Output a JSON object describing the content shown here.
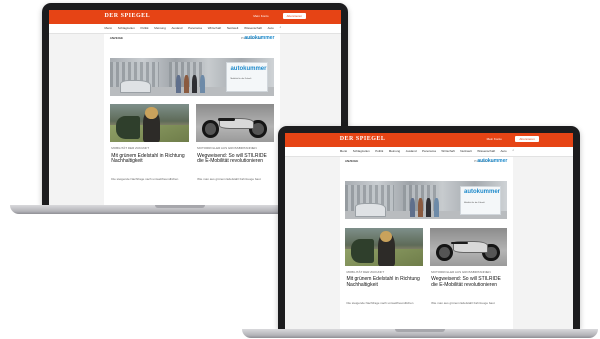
{
  "site": {
    "logo": "DER SPIEGEL",
    "account_link": "Mein Konto",
    "abo_button": "Abonnieren",
    "nav": [
      "Menü",
      "Schlagzeilen",
      "Politik",
      "Meinung",
      "Ausland",
      "Panorama",
      "Wirtschaft",
      "Netzwelt",
      "Wissenschaft",
      "Auto",
      "Sport",
      "Kultur"
    ],
    "search_icon": "search-icon",
    "label_anzeige": "ANZEIGE",
    "presented_by": "Präsentiert von",
    "sponsor_logo": "autokummer",
    "ad_sub": "Mobilität für die Zukunft",
    "articles": [
      {
        "kicker": "Mobilität der Zukunft",
        "headline": "Mit grünem Edelstahl in Richtung Nachhaltigkeit",
        "teaser": "Die steigende Nachfrage nach umweltfreundlichen"
      },
      {
        "kicker": "Motorroller aus Großbritannien",
        "headline": "Wegweisend: So will STILRIDE die E-Mobilität revolutionieren",
        "teaser": "Wie man aus grünem Edelstahl Fahrzeuge baut"
      }
    ]
  }
}
